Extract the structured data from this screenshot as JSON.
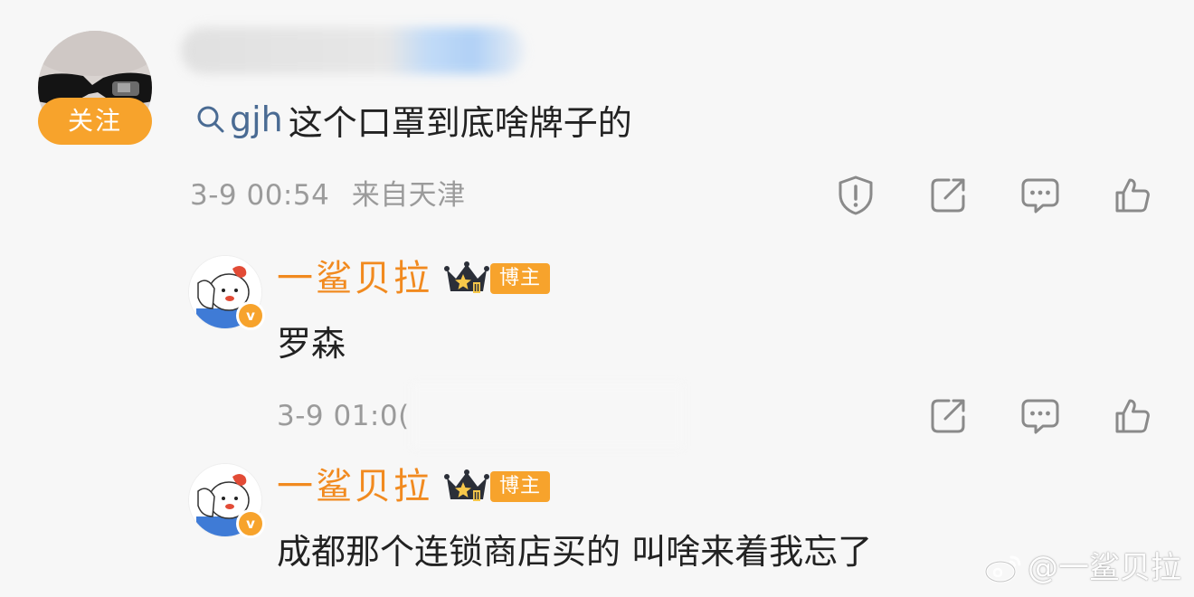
{
  "comment": {
    "follow_label": "关注",
    "mention_tag": "gjh",
    "text": "这个口罩到底啥牌子的",
    "date": "3-9 00:54",
    "location": "来自天津"
  },
  "replies": [
    {
      "name": "一鲨贝拉",
      "badge": "博主",
      "verified_mark": "v",
      "text": "罗森",
      "date": "3-9 01:0("
    },
    {
      "name": "一鲨贝拉",
      "badge": "博主",
      "verified_mark": "v",
      "text": "成都那个连锁商店买的 叫啥来着我忘了"
    }
  ],
  "watermark": "@一鲨贝拉",
  "icons": [
    "search-icon",
    "report-icon",
    "share-icon",
    "comment-icon",
    "like-icon",
    "crown-icon",
    "weibo-logo-icon"
  ],
  "colors": {
    "accent": "#f7a32c",
    "name": "#f18a1f",
    "meta": "#9b9b9b",
    "mention": "#4a6b93",
    "icon": "#8a8a8a",
    "background": "#f7f7f7"
  }
}
